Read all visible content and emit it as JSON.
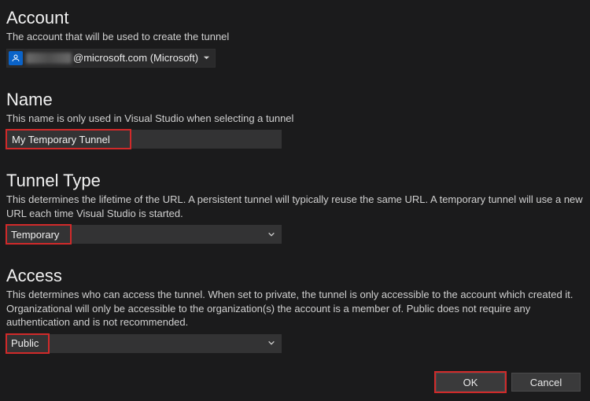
{
  "account": {
    "title": "Account",
    "description": "The account that will be used to create the tunnel",
    "email_suffix": "@microsoft.com (Microsoft)"
  },
  "name": {
    "title": "Name",
    "description": "This name is only used in Visual Studio when selecting a tunnel",
    "value": "My Temporary Tunnel"
  },
  "tunnel_type": {
    "title": "Tunnel Type",
    "description": "This determines the lifetime of the URL. A persistent tunnel will typically reuse the same URL. A temporary tunnel will use a new URL each time Visual Studio is started.",
    "selected": "Temporary"
  },
  "access": {
    "title": "Access",
    "description": "This determines who can access the tunnel. When set to private, the tunnel is only accessible to the account which created it. Organizational will only be accessible to the organization(s) the account is a member of. Public does not require any authentication and is not recommended.",
    "selected": "Public"
  },
  "buttons": {
    "ok": "OK",
    "cancel": "Cancel"
  }
}
